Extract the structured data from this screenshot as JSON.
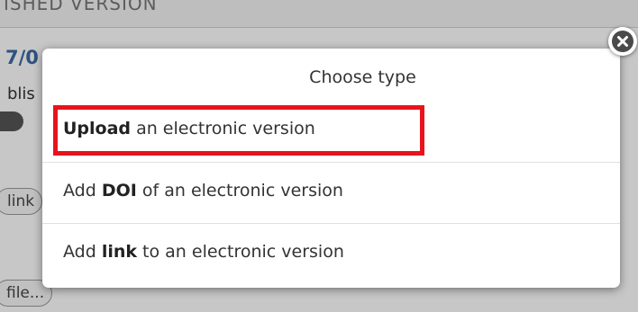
{
  "background": {
    "section_heading": "ISHED VERSION",
    "date": "7/0",
    "status": "blis",
    "link_pill": "link",
    "file_pill": "file..."
  },
  "popup": {
    "title": "Choose type",
    "options": [
      {
        "bold": "Upload",
        "rest": " an electronic version",
        "prefix": ""
      },
      {
        "prefix": "Add ",
        "bold": "DOI",
        "rest": " of an electronic version"
      },
      {
        "prefix": "Add ",
        "bold": "link",
        "rest": " to an electronic version"
      }
    ],
    "close_icon": "close-x-icon"
  },
  "colors": {
    "highlight": "#e8141c",
    "date_text": "#3a6ba5"
  }
}
